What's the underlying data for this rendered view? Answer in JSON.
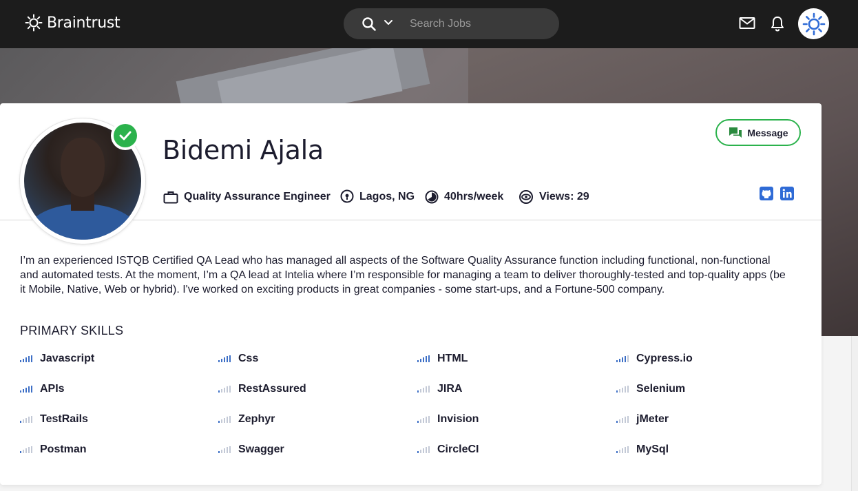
{
  "brand": {
    "name": "Braintrust"
  },
  "search": {
    "placeholder": "Search Jobs"
  },
  "profile": {
    "name": "Bidemi Ajala",
    "role": "Quality Assurance Engineer",
    "location": "Lagos, NG",
    "availability": "40hrs/week",
    "views": "Views: 29",
    "message_label": "Message",
    "bio": "I’m an experienced ISTQB Certified QA Lead who has managed all aspects of the Software Quality Assurance function including functional, non-functional and automated tests. At the moment, I’m a QA lead at Intelia where I’m responsible for managing a team to deliver thoroughly-tested and top-quality apps (be it Mobile, Native, Web or hybrid). I've worked on exciting products in great companies - some start-ups, and a Fortune-500 company."
  },
  "skills": {
    "title": "PRIMARY SKILLS",
    "items": [
      {
        "name": "Javascript",
        "level": 5
      },
      {
        "name": "Css",
        "level": 5
      },
      {
        "name": "HTML",
        "level": 5
      },
      {
        "name": "Cypress.io",
        "level": 4
      },
      {
        "name": "APIs",
        "level": 5
      },
      {
        "name": "RestAssured",
        "level": 1
      },
      {
        "name": "JIRA",
        "level": 1
      },
      {
        "name": "Selenium",
        "level": 1
      },
      {
        "name": "TestRails",
        "level": 1
      },
      {
        "name": "Zephyr",
        "level": 1
      },
      {
        "name": "Invision",
        "level": 1
      },
      {
        "name": "jMeter",
        "level": 1
      },
      {
        "name": "Postman",
        "level": 1
      },
      {
        "name": "Swagger",
        "level": 1
      },
      {
        "name": "CircleCI",
        "level": 1
      },
      {
        "name": "MySql",
        "level": 1
      }
    ]
  },
  "icons": {
    "logo": "sun-gear-icon",
    "search": "search-icon",
    "chevron": "chevron-down-icon",
    "mail": "mail-icon",
    "bell": "bell-icon",
    "role": "briefcase-icon",
    "location": "location-pin-icon",
    "availability": "clock-icon",
    "views": "eye-icon",
    "message": "chat-icon",
    "github": "github-icon",
    "linkedin": "linkedin-icon",
    "verified": "check-icon"
  },
  "colors": {
    "topbar": "#1c1c1c",
    "accent_green": "#2bb24c",
    "link_blue": "#2f6bd6",
    "skill_bar_on": "#3d6fc6",
    "skill_bar_off": "#c3c9d6"
  }
}
